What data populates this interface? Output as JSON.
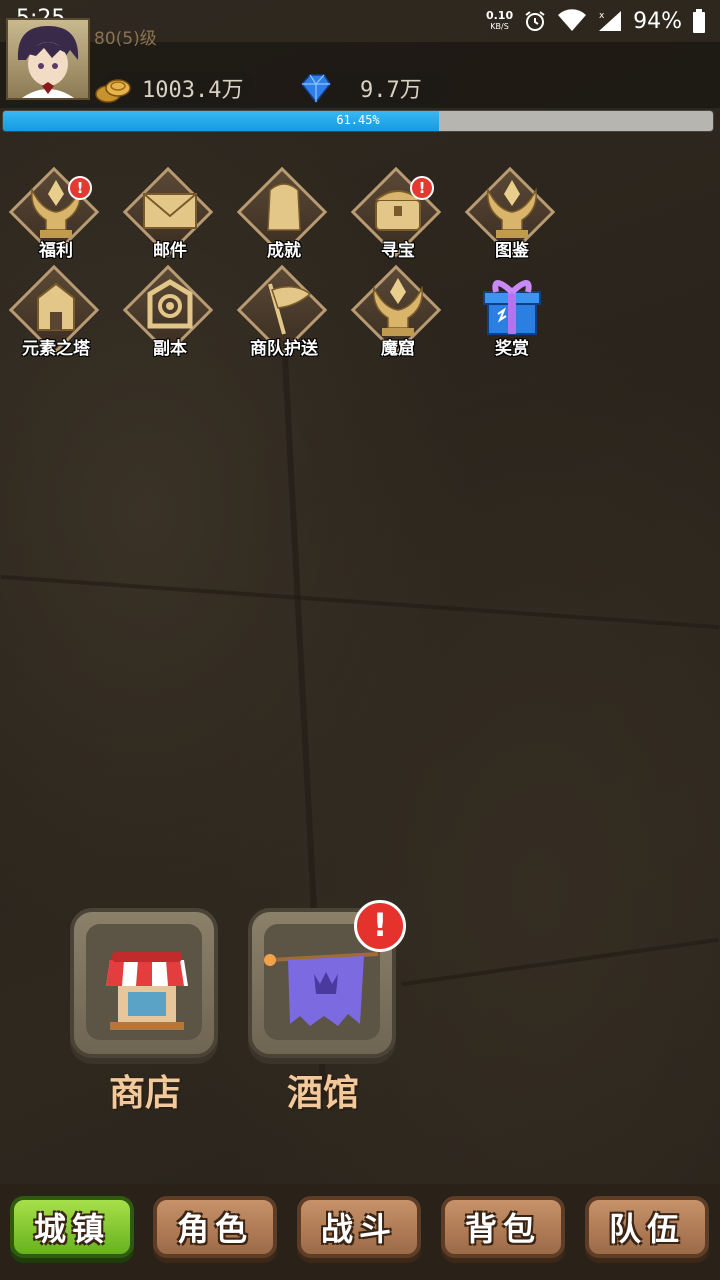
{
  "status_bar": {
    "time": "5:25",
    "net_speed_value": "0.10",
    "net_speed_unit": "KB/S",
    "battery": "94%",
    "icons": [
      "alarm-icon",
      "wifi-icon",
      "signal-icon",
      "battery-icon"
    ]
  },
  "player": {
    "level": "80(5)级",
    "gold": "1003.4万",
    "gems": "9.7万",
    "exp_percent": 61.45,
    "exp_label": "61.45%"
  },
  "features": [
    {
      "label": "福利",
      "icon": "trophy-icon",
      "alert": true
    },
    {
      "label": "邮件",
      "icon": "mail-icon",
      "alert": false
    },
    {
      "label": "成就",
      "icon": "achievement-icon",
      "alert": false
    },
    {
      "label": "寻宝",
      "icon": "treasure-chest-icon",
      "alert": true
    },
    {
      "label": "图鉴",
      "icon": "trophy-icon",
      "alert": false
    },
    {
      "label": "元素之塔",
      "icon": "tower-icon",
      "alert": false
    },
    {
      "label": "副本",
      "icon": "dungeon-icon",
      "alert": false
    },
    {
      "label": "商队护送",
      "icon": "flag-icon",
      "alert": false
    },
    {
      "label": "魔窟",
      "icon": "trophy-icon",
      "alert": false
    },
    {
      "label": "奖赏",
      "icon": "gift-box-icon",
      "alert": false
    }
  ],
  "buildings": [
    {
      "label": "商店",
      "icon": "shop-icon",
      "alert": false
    },
    {
      "label": "酒馆",
      "icon": "tavern-banner-icon",
      "alert": true
    }
  ],
  "alert_mark": "!",
  "nav": [
    {
      "label": "城镇",
      "active": true
    },
    {
      "label": "角色",
      "active": false
    },
    {
      "label": "战斗",
      "active": false
    },
    {
      "label": "背包",
      "active": false
    },
    {
      "label": "队伍",
      "active": false
    }
  ],
  "colors": {
    "exp_fill": "#1aa5ea",
    "gold_label": "#f3c89a",
    "nav_active": "#7cc22a",
    "nav_inactive": "#b07c55",
    "alert": "#e23a30"
  }
}
